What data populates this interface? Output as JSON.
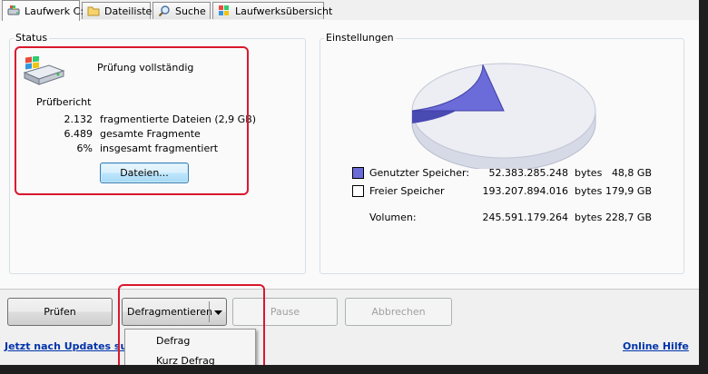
{
  "tabs": [
    {
      "label": "Laufwerk C:",
      "icon": "drive-icon"
    },
    {
      "label": "Dateiliste",
      "icon": "folder-icon"
    },
    {
      "label": "Suche",
      "icon": "search-icon"
    },
    {
      "label": "Laufwerksübersicht",
      "icon": "drive-map-icon"
    }
  ],
  "status": {
    "title": "Status",
    "message": "Prüfung vollständig",
    "report_title": "Prüfbericht",
    "rows": [
      {
        "value": "2.132",
        "label": "fragmentierte Dateien (2,9 GB)"
      },
      {
        "value": "6.489",
        "label": "gesamte Fragmente"
      },
      {
        "value": "6%",
        "label": "insgesamt fragmentiert"
      }
    ],
    "files_button": "Dateien..."
  },
  "settings": {
    "title": "Einstellungen",
    "rows": [
      {
        "label": "Genutzter Speicher:",
        "bytes": "52.383.285.248",
        "unit": "bytes",
        "gb": "48,8 GB"
      },
      {
        "label": "Freier Speicher",
        "bytes": "193.207.894.016",
        "unit": "bytes",
        "gb": "179,9 GB"
      },
      {
        "label": "Volumen:",
        "bytes": "245.591.179.264",
        "unit": "bytes",
        "gb": "228,7 GB"
      }
    ],
    "colors": {
      "used": "#6b6bd9",
      "free": "#ffffff"
    }
  },
  "chart_data": {
    "type": "pie",
    "categories": [
      "Genutzter Speicher",
      "Freier Speicher"
    ],
    "values": [
      52383285248,
      193207894016
    ]
  },
  "toolbar": {
    "check": "Prüfen",
    "defrag": "Defragmentieren",
    "pause": "Pause",
    "cancel": "Abbrechen"
  },
  "defrag_menu": [
    "Defrag",
    "Kurz Defrag"
  ],
  "footer": {
    "updates_link": "Jetzt nach Updates such",
    "help_link": "Online Hilfe"
  }
}
